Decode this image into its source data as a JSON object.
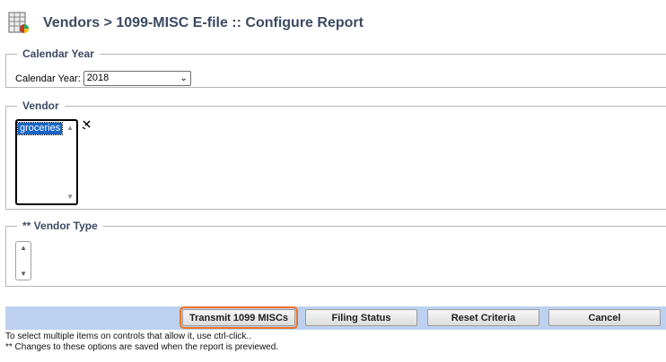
{
  "header": {
    "title": "Vendors > 1099-MISC E-file :: Configure Report",
    "icon": "report-grid-icon"
  },
  "calendar_year": {
    "legend": "Calendar Year",
    "label": "Calendar Year:",
    "selected": "2018"
  },
  "vendor": {
    "legend": "Vendor",
    "selected_item": "groceries",
    "clear_icon": "clear-selection-icon"
  },
  "vendor_type": {
    "legend": "** Vendor Type"
  },
  "toolbar": {
    "transmit_label": "Transmit 1099 MISCs",
    "filing_status_label": "Filing Status",
    "reset_label": "Reset Criteria",
    "cancel_label": "Cancel"
  },
  "notes": {
    "line1": "To select multiple items on controls that allow it, use ctrl-click..",
    "line2": "** Changes to these options are saved when the report is previewed."
  },
  "colors": {
    "title": "#3b4a63",
    "toolbar_bg": "#bcd1ef",
    "highlight": "#f07223",
    "selection": "#1764c4"
  }
}
